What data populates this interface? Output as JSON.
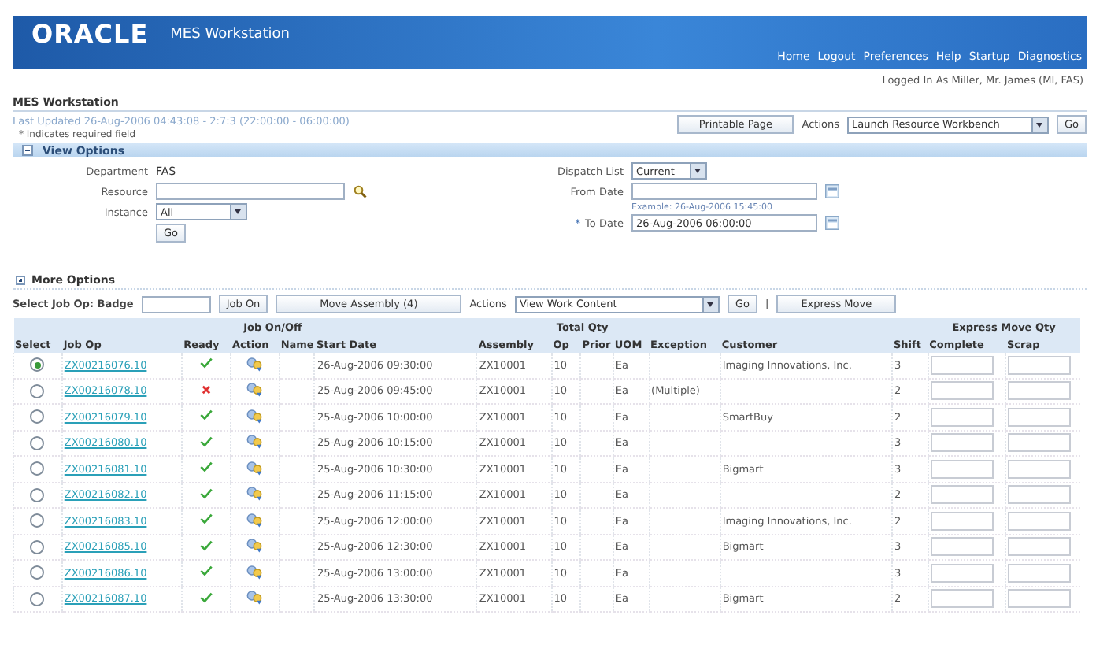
{
  "header": {
    "logo": "ORACLE",
    "app_title": "MES Workstation",
    "nav": [
      "Home",
      "Logout",
      "Preferences",
      "Help",
      "Startup",
      "Diagnostics"
    ],
    "logged_in": "Logged In As Miller, Mr. James (MI, FAS)"
  },
  "page": {
    "title": "MES Workstation",
    "last_updated": "Last Updated 26-Aug-2006 04:43:08 - 2:7:3 (22:00:00 - 06:00:00)",
    "required_note": "* Indicates required field",
    "printable_button": "Printable Page",
    "actions_label": "Actions",
    "actions_value": "Launch Resource Workbench",
    "go_button": "Go"
  },
  "view_options": {
    "title": "View Options",
    "expanded": true,
    "department_label": "Department",
    "department": "FAS",
    "resource_label": "Resource",
    "instance_label": "Instance",
    "instance_value": "All",
    "go_button": "Go",
    "dispatch_label": "Dispatch List",
    "dispatch_value": "Current",
    "from_label": "From Date",
    "from_hint": "Example: 26-Aug-2006 15:45:00",
    "to_required": "*",
    "to_label": "To Date",
    "to_value": "26-Aug-2006 06:00:00"
  },
  "more_options": {
    "title": "More Options",
    "expanded": false
  },
  "toolbar": {
    "badge_label": "Select Job Op: Badge",
    "job_on_button": "Job On",
    "move_button": "Move Assembly (4)",
    "actions_label": "Actions",
    "actions_value": "View Work Content",
    "go_button": "Go",
    "separator": "|",
    "express_button": "Express Move"
  },
  "table": {
    "columns": [
      {
        "label": "Select"
      },
      {
        "label": "Job Op"
      },
      {
        "label": "Ready"
      },
      {
        "group": "Job On/Off",
        "columns": [
          "Action",
          "Name"
        ]
      },
      {
        "label": "Start Date"
      },
      {
        "label": "Assembly"
      },
      {
        "group": "Total Qty",
        "columns": [
          "Op",
          "Prior"
        ]
      },
      {
        "label": "UOM"
      },
      {
        "label": "Exception"
      },
      {
        "label": "Customer"
      },
      {
        "label": "Shift"
      },
      {
        "group": "Express Move Qty",
        "columns": [
          "Complete",
          "Scrap"
        ]
      }
    ],
    "rows": [
      {
        "selected": true,
        "job_op": "ZX00216076.10",
        "ready": true,
        "start": "26-Aug-2006 09:30:00",
        "assembly": "ZX10001",
        "op": "10",
        "uom": "Ea",
        "exception": "",
        "customer": "Imaging Innovations, Inc.",
        "shift": "3"
      },
      {
        "selected": false,
        "job_op": "ZX00216078.10",
        "ready": false,
        "start": "25-Aug-2006 09:45:00",
        "assembly": "ZX10001",
        "op": "10",
        "uom": "Ea",
        "exception": "(Multiple)",
        "customer": "",
        "shift": "2"
      },
      {
        "selected": false,
        "job_op": "ZX00216079.10",
        "ready": true,
        "start": "25-Aug-2006 10:00:00",
        "assembly": "ZX10001",
        "op": "10",
        "uom": "Ea",
        "exception": "",
        "customer": "SmartBuy",
        "shift": "2"
      },
      {
        "selected": false,
        "job_op": "ZX00216080.10",
        "ready": true,
        "start": "25-Aug-2006 10:15:00",
        "assembly": "ZX10001",
        "op": "10",
        "uom": "Ea",
        "exception": "",
        "customer": "",
        "shift": "3"
      },
      {
        "selected": false,
        "job_op": "ZX00216081.10",
        "ready": true,
        "start": "25-Aug-2006 10:30:00",
        "assembly": "ZX10001",
        "op": "10",
        "uom": "Ea",
        "exception": "",
        "customer": "Bigmart",
        "shift": "3"
      },
      {
        "selected": false,
        "job_op": "ZX00216082.10",
        "ready": true,
        "start": "25-Aug-2006 11:15:00",
        "assembly": "ZX10001",
        "op": "10",
        "uom": "Ea",
        "exception": "",
        "customer": "",
        "shift": "2"
      },
      {
        "selected": false,
        "job_op": "ZX00216083.10",
        "ready": true,
        "start": "25-Aug-2006 12:00:00",
        "assembly": "ZX10001",
        "op": "10",
        "uom": "Ea",
        "exception": "",
        "customer": "Imaging Innovations, Inc.",
        "shift": "2"
      },
      {
        "selected": false,
        "job_op": "ZX00216085.10",
        "ready": true,
        "start": "25-Aug-2006 12:30:00",
        "assembly": "ZX10001",
        "op": "10",
        "uom": "Ea",
        "exception": "",
        "customer": "Bigmart",
        "shift": "3"
      },
      {
        "selected": false,
        "job_op": "ZX00216086.10",
        "ready": true,
        "start": "25-Aug-2006 13:00:00",
        "assembly": "ZX10001",
        "op": "10",
        "uom": "Ea",
        "exception": "",
        "customer": "",
        "shift": "3"
      },
      {
        "selected": false,
        "job_op": "ZX00216087.10",
        "ready": true,
        "start": "25-Aug-2006 13:30:00",
        "assembly": "ZX10001",
        "op": "10",
        "uom": "Ea",
        "exception": "",
        "customer": "Bigmart",
        "shift": "2"
      }
    ]
  }
}
